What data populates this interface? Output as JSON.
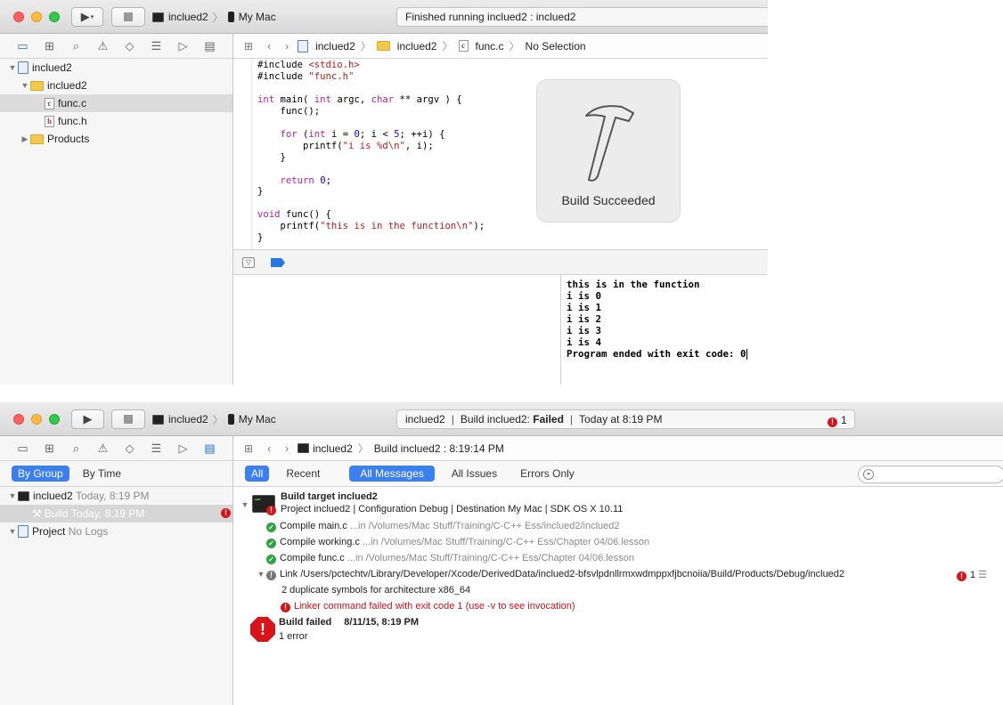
{
  "window1": {
    "toolbar": {
      "scheme_project": "inclued2",
      "scheme_target": "My Mac",
      "activity": "Finished running inclued2 : inclued2"
    },
    "jumpbar": {
      "project": "inclued2",
      "group": "inclued2",
      "file": "func.c",
      "symbol": "No Selection"
    },
    "navigator": {
      "items": [
        {
          "label": "inclued2"
        },
        {
          "label": "inclued2"
        },
        {
          "label": "func.c"
        },
        {
          "label": "func.h"
        },
        {
          "label": "Products"
        }
      ]
    },
    "code_lines": [
      "#include <stdio.h>",
      "#include \"func.h\"",
      "",
      "int main( int argc, char ** argv ) {",
      "    func();",
      "",
      "    for (int i = 0; i < 5; ++i) {",
      "        printf(\"i is %d\\n\", i);",
      "    }",
      "",
      "    return 0;",
      "}",
      "",
      "void func() {",
      "    printf(\"this is in the function\\n\");",
      "}"
    ],
    "hud": {
      "message": "Build Succeeded"
    },
    "console_lines": [
      "this is in the function",
      "i is 0",
      "i is 1",
      "i is 2",
      "i is 3",
      "i is 4",
      "Program ended with exit code: 0"
    ]
  },
  "window2": {
    "toolbar": {
      "scheme_project": "inclued2",
      "scheme_target": "My Mac",
      "activity_project": "inclued2",
      "activity_prefix": "Build inclued2:",
      "activity_status": "Failed",
      "activity_time": "Today at 8:19 PM",
      "error_count": "1"
    },
    "jumpbar": {
      "project": "inclued2",
      "item": "Build inclued2 : 8:19:14 PM"
    },
    "by_tabs": {
      "group": "By Group",
      "time": "By Time"
    },
    "report_tree": {
      "project": "inclued2",
      "project_time": "Today, 8:19 PM",
      "build": "Build",
      "build_time": "Today, 8:19 PM",
      "project2": "Project",
      "project2_note": "No Logs"
    },
    "filters": {
      "all": "All",
      "recent": "Recent",
      "all_messages": "All Messages",
      "all_issues": "All Issues",
      "errors_only": "Errors Only"
    },
    "log": {
      "target_title": "Build target inclued2",
      "target_info": "Project inclued2 | Configuration Debug | Destination My Mac | SDK OS X 10.11",
      "compiles": [
        {
          "label": "Compile main.c",
          "path": "...in /Volumes/Mac Stuff/Training/C-C++ Ess/inclued2/inclued2"
        },
        {
          "label": "Compile working.c",
          "path": "...in /Volumes/Mac Stuff/Training/C-C++ Ess/Chapter 04/06.lesson"
        },
        {
          "label": "Compile func.c",
          "path": "...in /Volumes/Mac Stuff/Training/C-C++ Ess/Chapter 04/06.lesson"
        }
      ],
      "link": "Link /Users/pctechtv/Library/Developer/Xcode/DerivedData/inclued2-bfsvlpdnllrmxwdmppxfjbcnoiia/Build/Products/Debug/inclued2",
      "link_errors": "1",
      "dup_symbols": "2 duplicate symbols for architecture x86_64",
      "linker_error": "Linker command failed with exit code 1 (use -v to see invocation)",
      "build_failed": "Build failed",
      "build_failed_time": "8/11/15, 8:19 PM",
      "error_summary": "1 error"
    }
  }
}
